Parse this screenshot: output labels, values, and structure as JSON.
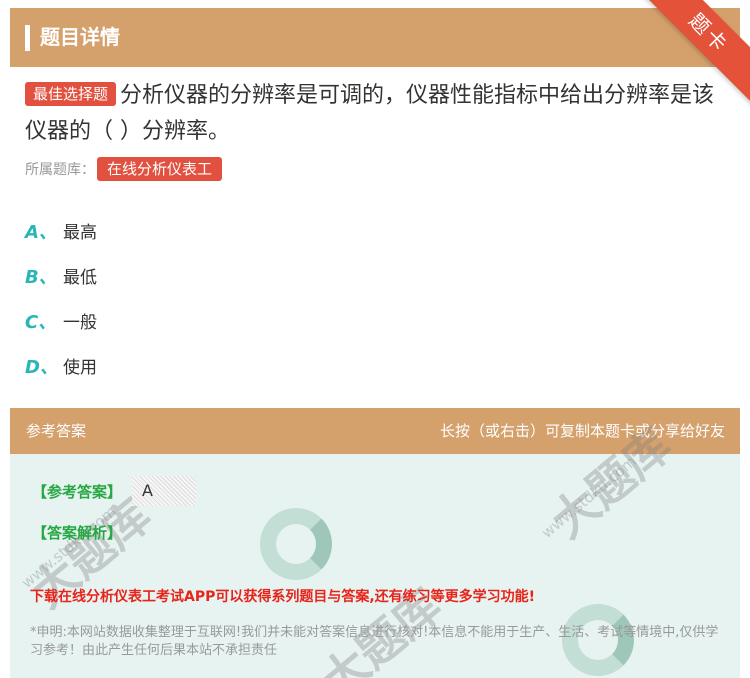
{
  "header": {
    "title": "题目详情",
    "ribbon": "题卡"
  },
  "question": {
    "tag": "最佳选择题",
    "text": "分析仪器的分辨率是可调的，仪器性能指标中给出分辨率是该仪器的（  ）分辨率。",
    "source_label": "所属题库：",
    "source_tag": "在线分析仪表工"
  },
  "options": [
    {
      "letter": "A、",
      "text": "最高"
    },
    {
      "letter": "B、",
      "text": "最低"
    },
    {
      "letter": "C、",
      "text": "一般"
    },
    {
      "letter": "D、",
      "text": "使用"
    }
  ],
  "answer": {
    "header_left": "参考答案",
    "header_right": "长按（或右击）可复制本题卡或分享给好友",
    "ref_label": "【参考答案】",
    "ref_value": "A",
    "analysis_label": "【答案解析】",
    "download": "下载在线分析仪表工考试APP可以获得系列题目与答案,还有练习等更多学习功能!",
    "disclaimer": "*申明:本网站数据收集整理于互联网!我们并未能对答案信息进行核对!本信息不能用于生产、生活、考试等情境中,仅供学习参考！由此产生任何后果本站不承担责任"
  },
  "watermark": {
    "large": "大题库",
    "small": "www.stdku.com"
  },
  "colors": {
    "header": "#d4a06c",
    "tag": "#e2513f",
    "option_letter": "#2ab6b6",
    "answer_label": "#27a844",
    "download": "#e8231a"
  }
}
